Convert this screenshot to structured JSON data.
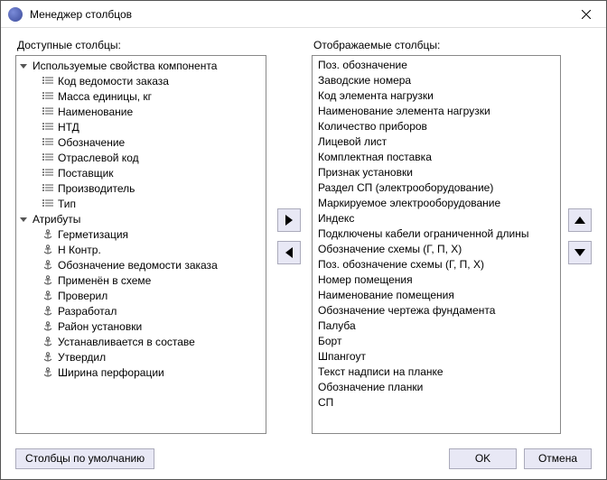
{
  "window": {
    "title": "Менеджер столбцов"
  },
  "labels": {
    "available": "Доступные столбцы:",
    "displayed": "Отображаемые столбцы:"
  },
  "available": {
    "groups": [
      {
        "name": "Используемые свойства компонента",
        "expanded": true,
        "icon": "property",
        "items": [
          "Код ведомости заказа",
          "Масса единицы, кг",
          "Наименование",
          "НТД",
          "Обозначение",
          "Отраслевой код",
          "Поставщик",
          "Производитель",
          "Тип"
        ]
      },
      {
        "name": "Атрибуты",
        "expanded": true,
        "icon": "attribute",
        "items": [
          "Герметизация",
          "Н Контр.",
          "Обозначение ведомости заказа",
          "Применён в схеме",
          "Проверил",
          "Разработал",
          "Район установки",
          "Устанавливается в составе",
          "Утвердил",
          "Ширина перфорации"
        ]
      }
    ]
  },
  "displayed": [
    "Поз. обозначение",
    "Заводские номера",
    "Код элемента нагрузки",
    "Наименование элемента нагрузки",
    "Количество приборов",
    "Лицевой лист",
    "Комплектная поставка",
    "Признак установки",
    "Раздел СП (электрооборудование)",
    "Маркируемое электрооборудование",
    "Индекс",
    "Подключены кабели ограниченной длины",
    "Обозначение схемы (Г, П, Х)",
    "Поз. обозначение схемы (Г, П, Х)",
    "Номер помещения",
    "Наименование помещения",
    "Обозначение чертежа фундамента",
    "Палуба",
    "Борт",
    "Шпангоут",
    "Текст надписи на планке",
    "Обозначение планки",
    "СП"
  ],
  "buttons": {
    "defaults": "Столбцы по умолчанию",
    "ok": "OK",
    "cancel": "Отмена"
  }
}
